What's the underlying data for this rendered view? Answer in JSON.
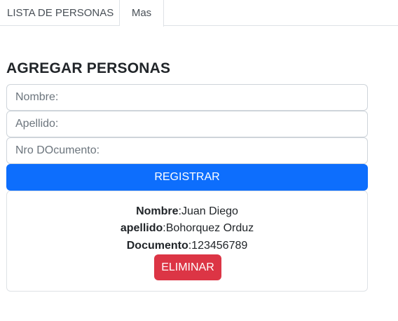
{
  "tabs": [
    {
      "label": "LISTA DE PERSONAS"
    },
    {
      "label": "Mas"
    }
  ],
  "form": {
    "title": "AGREGAR PERSONAS",
    "nombre_placeholder": "Nombre:",
    "apellido_placeholder": "Apellido:",
    "documento_placeholder": "Nro DOcumento:",
    "submit_label": "REGISTRAR"
  },
  "person": {
    "nombre_label": "Nombre",
    "nombre_value": ":Juan Diego",
    "apellido_label": "apellido",
    "apellido_value": ":Bohorquez Orduz",
    "documento_label": "Documento",
    "documento_value": ":123456789",
    "delete_label": "ELIMINAR"
  },
  "colors": {
    "primary": "#0d6efd",
    "danger": "#dc3545",
    "border": "#dee2e6"
  }
}
